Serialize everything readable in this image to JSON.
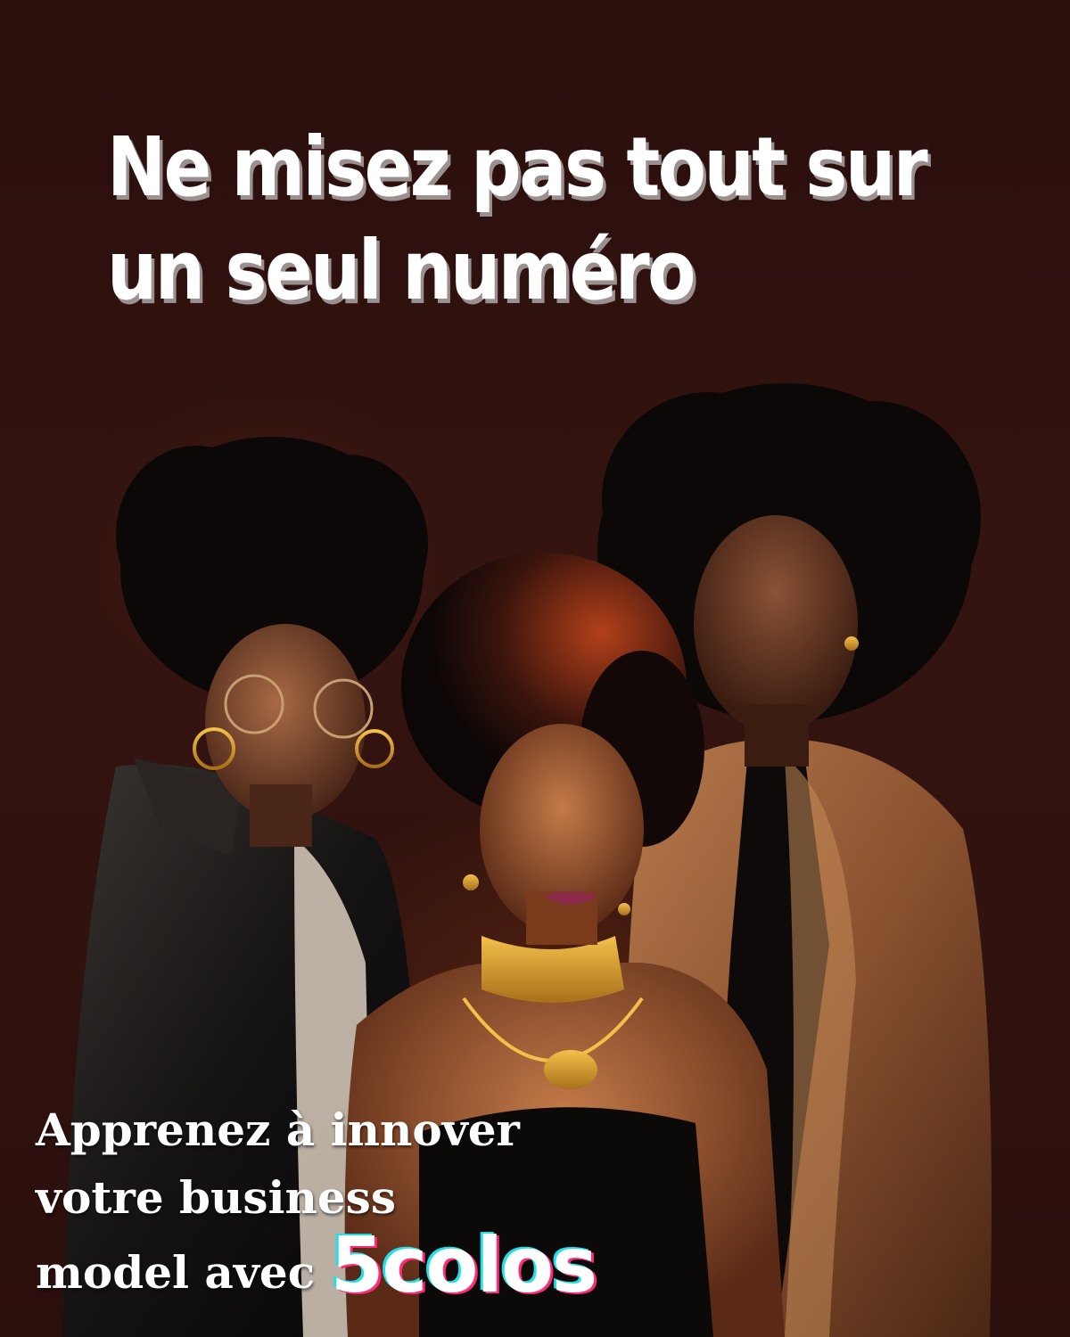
{
  "headline": {
    "line1": "Ne misez pas tout sur",
    "line2": "un seul numéro"
  },
  "tagline": {
    "line1": "Apprenez à innover",
    "line2": "votre business",
    "line3_prefix": "model avec"
  },
  "brand": {
    "name": "5colos",
    "color_cyan": "#22e0e8",
    "color_pink": "#ff2a78"
  },
  "colors": {
    "background": "#2f1210",
    "text": "#ffffff",
    "headline_shadow": "#9a9090"
  }
}
